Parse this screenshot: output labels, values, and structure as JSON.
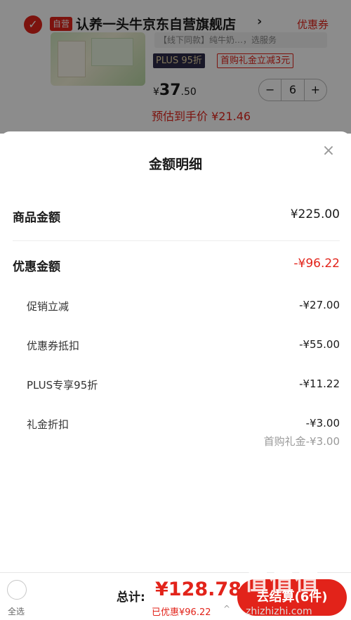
{
  "cart": {
    "self_badge": "自营",
    "store_name": "认养一头牛京东自营旗舰店",
    "coupon_link": "优惠券",
    "spec_text": "【线下同款】纯牛奶…，选服务",
    "plus_tag": "PLUS 95折",
    "gift_tag": "首购礼金立减3元",
    "price_symbol": "¥",
    "price_int": "37",
    "price_dec": ".50",
    "quantity": "6",
    "minus": "−",
    "plus": "+",
    "estimated_price": "预估到手价 ¥21.46"
  },
  "sheet": {
    "title": "金额明细",
    "close": "×",
    "goods_label": "商品金额",
    "goods_value": "¥225.00",
    "discount_label": "优惠金额",
    "discount_value": "-¥96.22",
    "items": [
      {
        "label": "促销立减",
        "value": "-¥27.00"
      },
      {
        "label": "优惠券抵扣",
        "value": "-¥55.00"
      },
      {
        "label": "PLUS专享95折",
        "value": "-¥11.22"
      },
      {
        "label": "礼金折扣",
        "value": "-¥3.00"
      }
    ],
    "gift_note": "首购礼金-¥3.00"
  },
  "bottom": {
    "select_all": "全选",
    "total_label": "总计:",
    "total_value": "¥128.78",
    "saved": "已优惠¥96.22",
    "saved_arrow": "^",
    "checkout": "去结算(6件)"
  },
  "watermark": {
    "text": "值值值",
    "url": "zhizhizhi.com"
  },
  "colors": {
    "accent": "#e2231a",
    "plus_bg": "#2c2a4a"
  }
}
